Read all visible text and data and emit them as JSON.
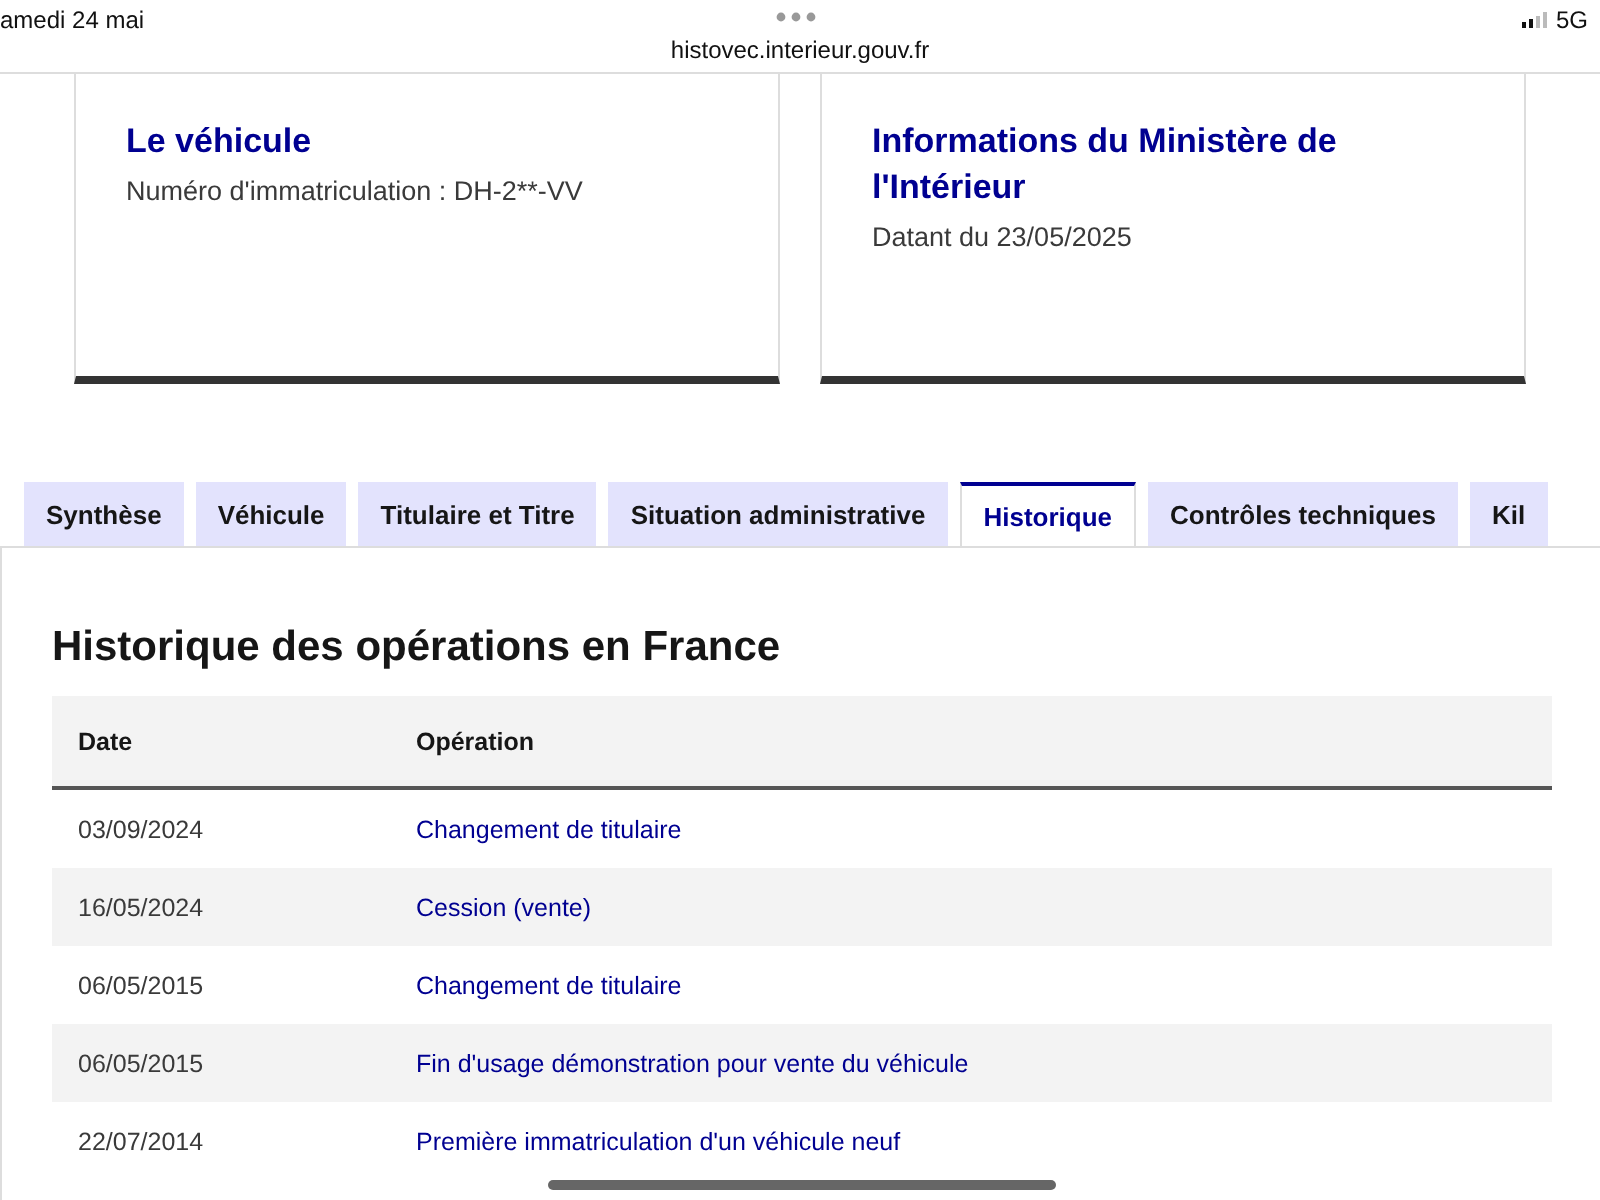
{
  "status_bar": {
    "date": "amedi 24 mai",
    "url": "histovec.interieur.gouv.fr",
    "network": "5G"
  },
  "cards": [
    {
      "title": "Le véhicule",
      "text": "Numéro d'immatriculation : DH-2**-VV"
    },
    {
      "title": "Informations du Ministère de l'Intérieur",
      "text": "Datant du 23/05/2025"
    }
  ],
  "tabs": [
    {
      "label": "Synthèse",
      "selected": false
    },
    {
      "label": "Véhicule",
      "selected": false
    },
    {
      "label": "Titulaire et Titre",
      "selected": false
    },
    {
      "label": "Situation administrative",
      "selected": false
    },
    {
      "label": "Historique",
      "selected": true
    },
    {
      "label": "Contrôles techniques",
      "selected": false
    },
    {
      "label": "Kil",
      "selected": false
    }
  ],
  "section_title": "Historique des opérations en France",
  "table": {
    "columns": [
      "Date",
      "Opération"
    ],
    "rows": [
      [
        "03/09/2024",
        "Changement de titulaire"
      ],
      [
        "16/05/2024",
        "Cession (vente)"
      ],
      [
        "06/05/2015",
        "Changement de titulaire"
      ],
      [
        "06/05/2015",
        "Fin d'usage démonstration pour vente du véhicule"
      ],
      [
        "22/07/2014",
        "Première immatriculation d'un véhicule neuf"
      ]
    ]
  }
}
